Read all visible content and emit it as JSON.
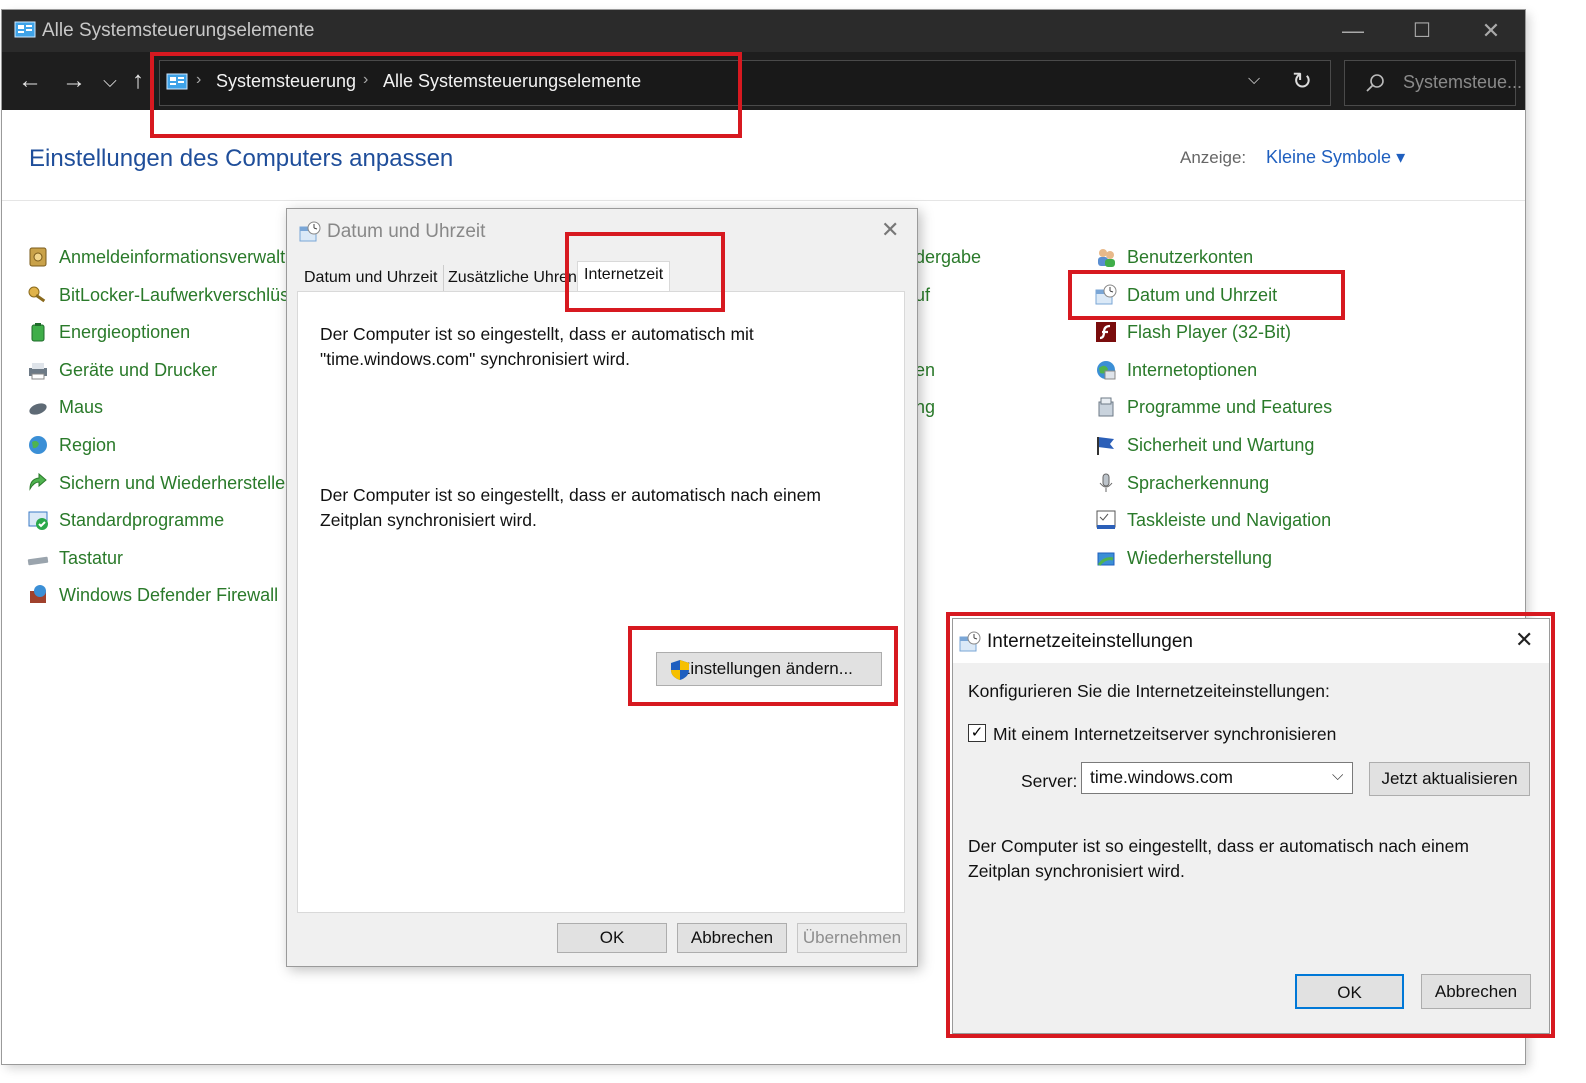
{
  "window": {
    "title": "Alle Systemsteuerungselemente",
    "minimize": "—",
    "maximize": "☐",
    "close": "✕"
  },
  "nav": {
    "back": "←",
    "forward": "→",
    "recent": "⌵",
    "up": "↑",
    "breadcrumb": [
      "Systemsteuerung",
      "Alle Systemsteuerungselemente"
    ],
    "crumb_sep": "›",
    "dropdown": "⌵",
    "refresh": "↻",
    "search_placeholder": "Systemsteue..."
  },
  "main": {
    "heading": "Einstellungen des Computers anpassen",
    "view_label": "Anzeige:",
    "view_value": "Kleine Symbole ▾"
  },
  "column1": [
    {
      "label": "Anmeldeinformationsverwaltu",
      "icon": "vault-icon"
    },
    {
      "label": "BitLocker-Laufwerkverschlüsse",
      "icon": "bitlocker-key-icon"
    },
    {
      "label": "Energieoptionen",
      "icon": "power-battery-icon"
    },
    {
      "label": "Geräte und Drucker",
      "icon": "printer-icon"
    },
    {
      "label": "Maus",
      "icon": "mouse-icon"
    },
    {
      "label": "Region",
      "icon": "globe-clock-icon"
    },
    {
      "label": "Sichern und Wiederherstellen",
      "icon": "backup-icon"
    },
    {
      "label": "Standardprogramme",
      "icon": "default-programs-icon"
    },
    {
      "label": "Tastatur",
      "icon": "keyboard-icon"
    },
    {
      "label": "Windows Defender Firewall",
      "icon": "firewall-icon"
    }
  ],
  "column2_partial": [
    "dergabe",
    "uf",
    "en",
    "ng"
  ],
  "column3": [
    {
      "label": "Benutzerkonten",
      "icon": "users-icon"
    },
    {
      "label": "Datum und Uhrzeit",
      "icon": "date-time-icon"
    },
    {
      "label": "Flash Player (32-Bit)",
      "icon": "flash-icon"
    },
    {
      "label": "Internetoptionen",
      "icon": "internet-options-icon"
    },
    {
      "label": "Programme und Features",
      "icon": "programs-icon"
    },
    {
      "label": "Sicherheit und Wartung",
      "icon": "flag-icon"
    },
    {
      "label": "Spracherkennung",
      "icon": "microphone-icon"
    },
    {
      "label": "Taskleiste und Navigation",
      "icon": "taskbar-icon"
    },
    {
      "label": "Wiederherstellung",
      "icon": "recovery-icon"
    }
  ],
  "dialog1": {
    "title": "Datum und Uhrzeit",
    "close": "✕",
    "tabs": [
      "Datum und Uhrzeit",
      "Zusätzliche Uhren",
      "Internetzeit"
    ],
    "text1_line1": "Der Computer ist so eingestellt, dass er automatisch mit",
    "text1_line2": "\"time.windows.com\" synchronisiert wird.",
    "text2_line1": "Der Computer ist so eingestellt, dass er automatisch nach einem",
    "text2_line2": "Zeitplan synchronisiert wird.",
    "change_button": "Einstellungen ändern...",
    "ok": "OK",
    "cancel": "Abbrechen",
    "apply": "Übernehmen"
  },
  "dialog2": {
    "title": "Internetzeiteinstellungen",
    "close": "✕",
    "configure_label": "Konfigurieren Sie die Internetzeiteinstellungen:",
    "sync_checkbox": "Mit einem Internetzeitserver synchronisieren",
    "sync_checked": true,
    "checkmark": "✓",
    "server_label": "Server:",
    "server_value": "time.windows.com",
    "dropdown_arrow": "⌵",
    "update_now": "Jetzt aktualisieren",
    "info_line1": "Der Computer ist so eingestellt, dass er automatisch nach einem",
    "info_line2": "Zeitplan synchronisiert wird.",
    "ok": "OK",
    "cancel": "Abbrechen"
  },
  "colors": {
    "link_green": "#2a7a2a",
    "heading_blue": "#1f4e9a",
    "highlight_red": "#d71920",
    "titlebar_dark": "#2b2b2b"
  }
}
